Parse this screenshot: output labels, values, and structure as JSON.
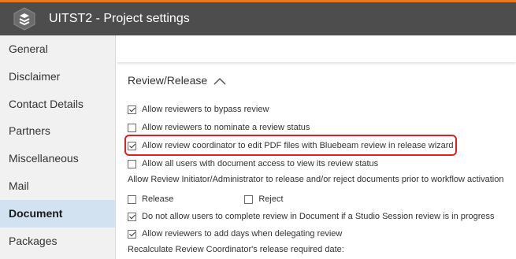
{
  "window": {
    "title": "UITST2 - Project settings"
  },
  "sidebar": {
    "items": [
      {
        "label": "General"
      },
      {
        "label": "Disclaimer"
      },
      {
        "label": "Contact Details"
      },
      {
        "label": "Partners"
      },
      {
        "label": "Miscellaneous"
      },
      {
        "label": "Mail"
      },
      {
        "label": "Document"
      },
      {
        "label": "Packages"
      }
    ],
    "active": "Document"
  },
  "section": {
    "title": "Review/Release",
    "expanded": true
  },
  "options": [
    {
      "label": "Allow reviewers to bypass review",
      "checked": true
    },
    {
      "label": "Allow reviewers to nominate a review status",
      "checked": false
    },
    {
      "label": "Allow review coordinator to edit PDF files with Bluebeam review in release wizard",
      "checked": true,
      "highlighted": true
    },
    {
      "label": "Allow all users with document access to view its review status",
      "checked": false
    }
  ],
  "release_reject": {
    "label": "Allow Review Initiator/Administrator to release and/or reject documents prior to workflow activation",
    "release": {
      "label": "Release",
      "checked": false
    },
    "reject": {
      "label": "Reject",
      "checked": false
    }
  },
  "options2": [
    {
      "label": "Do not allow users to complete review in Document if a Studio Session review is in progress",
      "checked": true
    },
    {
      "label": "Allow reviewers to add days when delegating review",
      "checked": true
    }
  ],
  "recalc_label": "Recalculate Review Coordinator's release required date:",
  "colors": {
    "accent": "#e8791e",
    "titlebar": "#4d4d4d",
    "active_nav": "#d2e2f1",
    "highlight": "#e51c23"
  },
  "icons": {
    "app_logo": "app-logo-icon",
    "collapse": "chevron-up-icon"
  }
}
